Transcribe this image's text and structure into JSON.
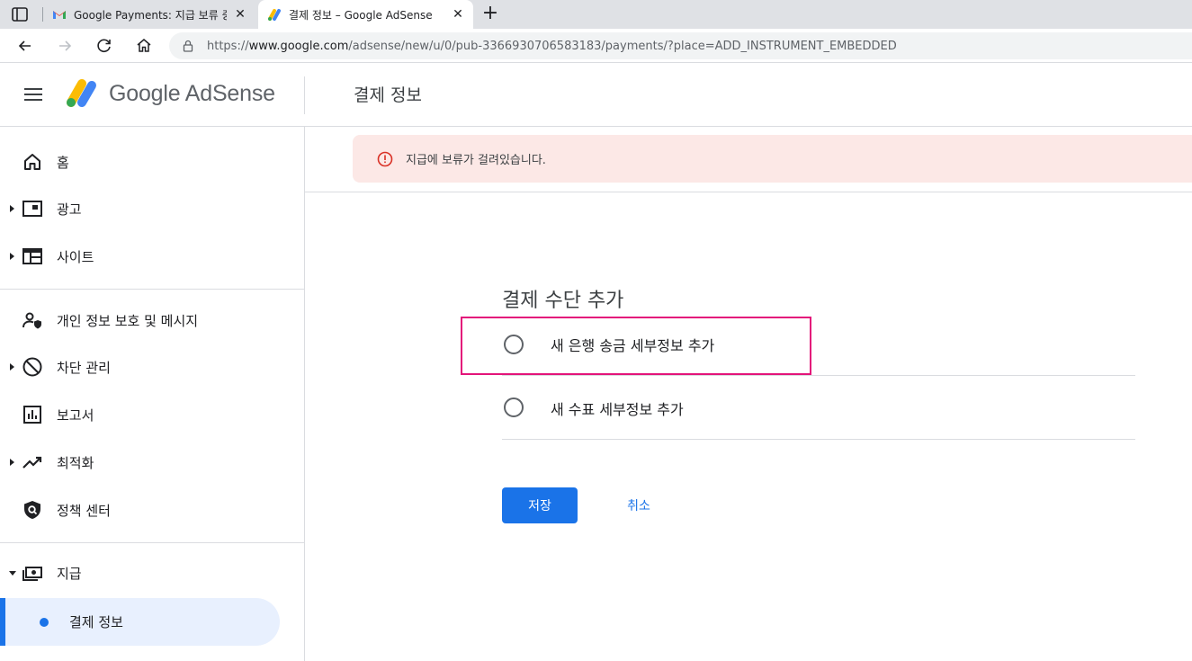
{
  "browser": {
    "tabs": [
      {
        "title": "Google Payments: 지급 보류 중 -",
        "icon": "gmail-icon"
      },
      {
        "title": "결제 정보 – Google AdSense",
        "icon": "adsense-icon"
      }
    ],
    "url_prefix": "https://",
    "url_domain": "www.google.com",
    "url_path": "/adsense/new/u/0/pub-3366930706583183/payments/?place=ADD_INSTRUMENT_EMBEDDED"
  },
  "header": {
    "logo_text": "Google AdSense",
    "page_title": "결제 정보"
  },
  "sidebar": {
    "items": [
      {
        "label": "홈",
        "icon": "home-icon"
      },
      {
        "label": "광고",
        "icon": "ads-icon"
      },
      {
        "label": "사이트",
        "icon": "sites-icon"
      },
      {
        "label": "개인 정보 보호 및 메시지",
        "icon": "privacy-icon"
      },
      {
        "label": "차단 관리",
        "icon": "block-icon"
      },
      {
        "label": "보고서",
        "icon": "reports-icon"
      },
      {
        "label": "최적화",
        "icon": "trending-icon"
      },
      {
        "label": "정책 센터",
        "icon": "policy-shield-icon"
      },
      {
        "label": "지급",
        "icon": "payments-icon"
      }
    ],
    "active_sub": "결제 정보"
  },
  "main": {
    "alert": "지급에 보류가 걸려있습니다.",
    "section_title": "결제 수단 추가",
    "options": [
      {
        "label": "새 은행 송금 세부정보 추가"
      },
      {
        "label": "새 수표 세부정보 추가"
      }
    ],
    "save_label": "저장",
    "cancel_label": "취소"
  },
  "colors": {
    "accent": "#1a73e8",
    "alert_bg": "#fce8e6",
    "alert_icon": "#d93025",
    "highlight": "#e3147a"
  }
}
